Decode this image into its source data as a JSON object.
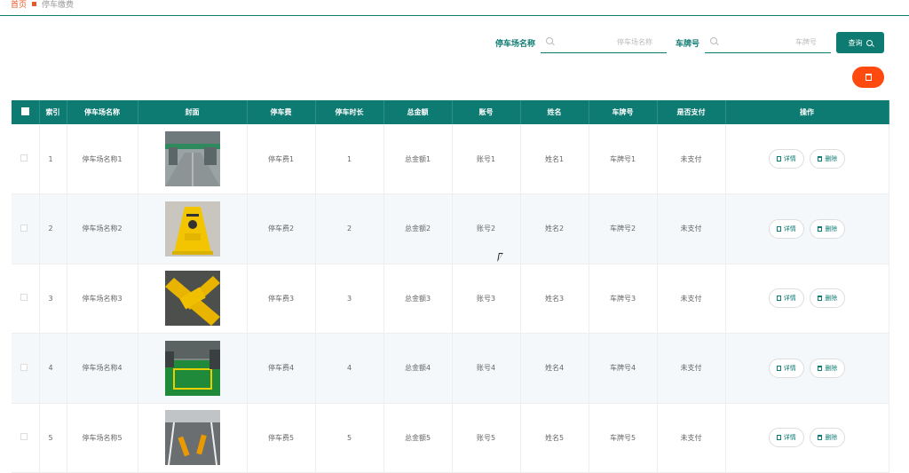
{
  "breadcrumb": {
    "home": "首页",
    "current": "停车缴费"
  },
  "search": {
    "lot_label": "停车场名称",
    "lot_placeholder": "停车场名称",
    "plate_label": "车牌号",
    "plate_placeholder": "车牌号",
    "query_label": "查询"
  },
  "table": {
    "headers": [
      "",
      "索引",
      "停车场名称",
      "封面",
      "停车费",
      "停车时长",
      "总金额",
      "账号",
      "姓名",
      "车牌号",
      "是否支付",
      "操作"
    ],
    "actions": {
      "detail": "详情",
      "delete": "删除"
    },
    "rows": [
      {
        "index": "1",
        "lot": "停车场名称1",
        "fee": "停车费1",
        "duration": "1",
        "total": "总金额1",
        "account": "账号1",
        "name": "姓名1",
        "plate": "车牌号1",
        "paid": "未支付",
        "cover": "garage-interior"
      },
      {
        "index": "2",
        "lot": "停车场名称2",
        "fee": "停车费2",
        "duration": "2",
        "total": "总金额2",
        "account": "账号2",
        "name": "姓名2",
        "plate": "车牌号2",
        "paid": "未支付",
        "cover": "yellow-parking-sign"
      },
      {
        "index": "3",
        "lot": "停车场名称3",
        "fee": "停车费3",
        "duration": "3",
        "total": "总金额3",
        "account": "账号3",
        "name": "姓名3",
        "plate": "车牌号3",
        "paid": "未支付",
        "cover": "yellow-parking-marking"
      },
      {
        "index": "4",
        "lot": "停车场名称4",
        "fee": "停车费4",
        "duration": "4",
        "total": "总金额4",
        "account": "账号4",
        "name": "姓名4",
        "plate": "车牌号4",
        "paid": "未支付",
        "cover": "green-parking-space"
      },
      {
        "index": "5",
        "lot": "停车场名称5",
        "fee": "停车费5",
        "duration": "5",
        "total": "总金额5",
        "account": "账号5",
        "name": "姓名5",
        "plate": "车牌号5",
        "paid": "未支付",
        "cover": "parking-lot-bollards"
      }
    ]
  },
  "colors": {
    "accent": "#0e7b73",
    "danger": "#ff4a0f",
    "breadcrumb_home": "#e45a2c"
  }
}
